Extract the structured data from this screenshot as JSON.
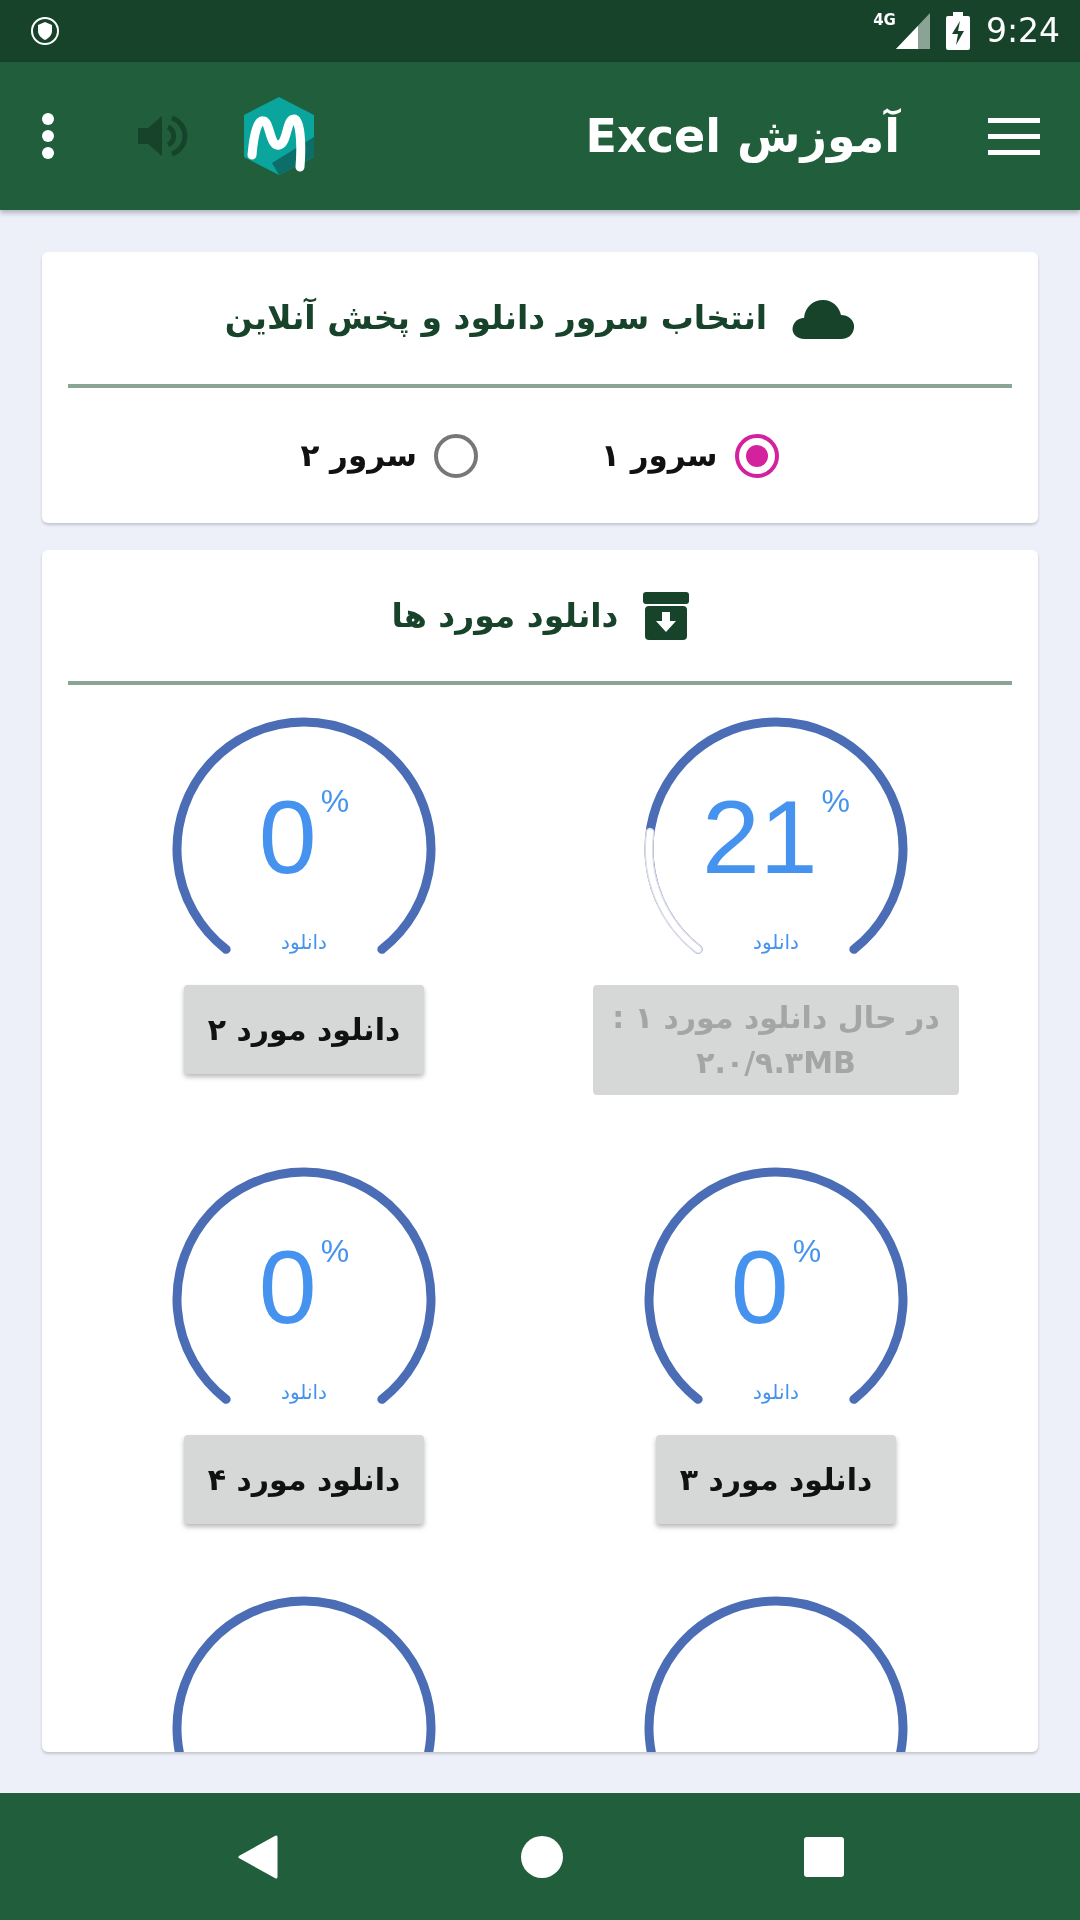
{
  "status_bar": {
    "network": "4G",
    "time": "9:24"
  },
  "app_bar": {
    "title": "آموزش Excel"
  },
  "server_card": {
    "title": "انتخاب سرور دانلود و پخش آنلاین",
    "options": [
      {
        "label": "سرور ۱",
        "selected": true
      },
      {
        "label": "سرور ۲",
        "selected": false
      }
    ]
  },
  "downloads_card": {
    "title": "دانلود مورد ها",
    "items": [
      {
        "kind": "gauge",
        "value": "21",
        "unit": "%",
        "caption": "دانلود",
        "level": 0.21,
        "button": {
          "label": "در حال دانلود مورد ۱ :\n۲.۰/۹.۳MB",
          "disabled": true
        }
      },
      {
        "kind": "gauge",
        "value": "0",
        "unit": "%",
        "caption": "دانلود",
        "button": {
          "label": "دانلود مورد ۲",
          "disabled": false
        }
      },
      {
        "kind": "gauge",
        "value": "0",
        "unit": "%",
        "caption": "دانلود",
        "button": {
          "label": "دانلود مورد ۳",
          "disabled": false
        }
      },
      {
        "kind": "gauge",
        "value": "0",
        "unit": "%",
        "caption": "دانلود",
        "button": {
          "label": "دانلود مورد ۴",
          "disabled": false
        }
      },
      {
        "kind": "gauge"
      },
      {
        "kind": "gauge"
      }
    ]
  }
}
